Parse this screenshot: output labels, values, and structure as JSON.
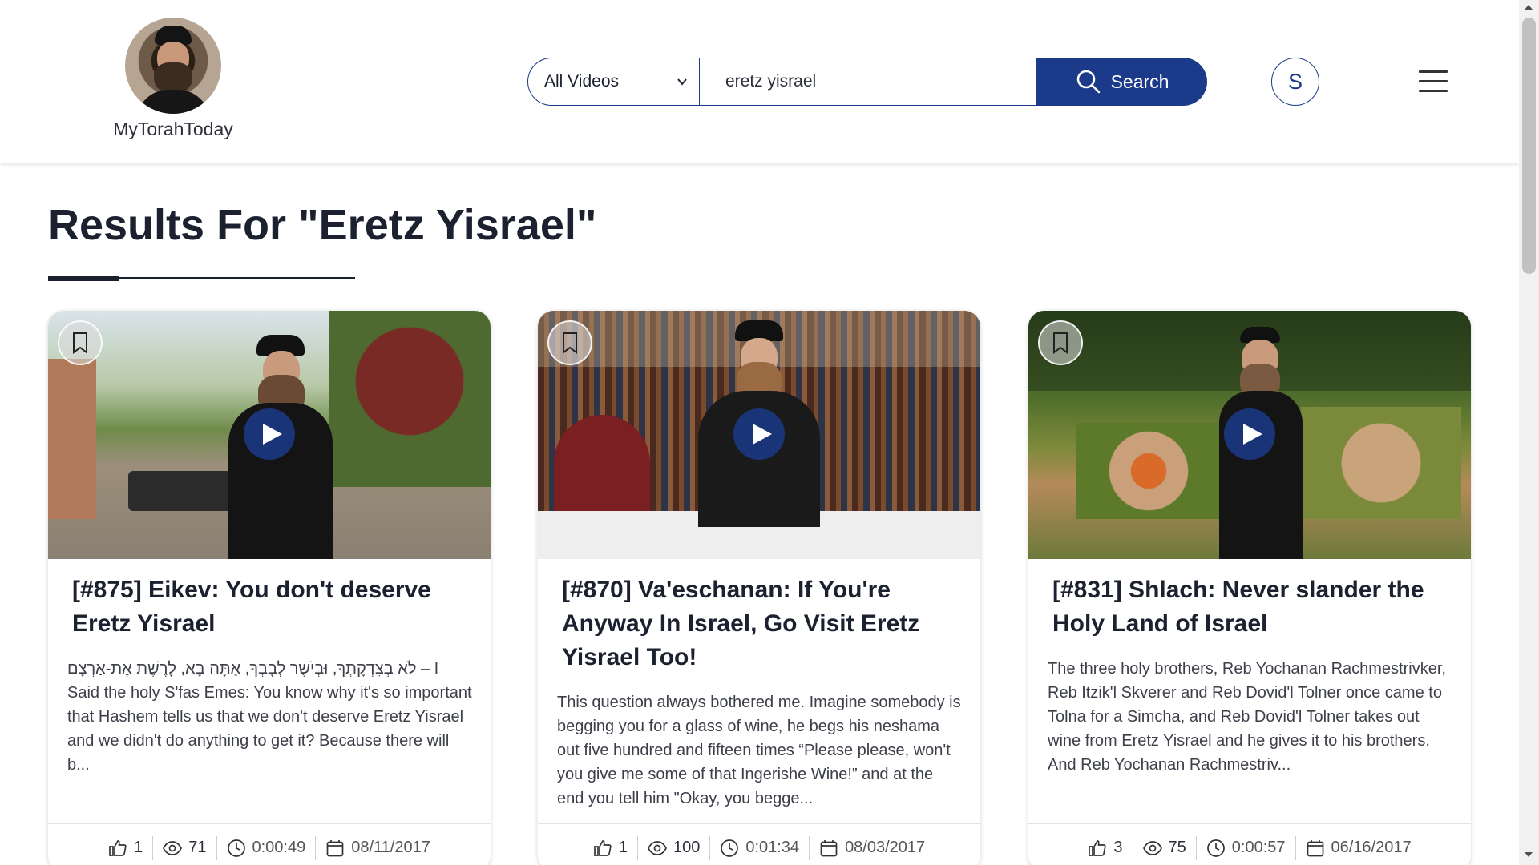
{
  "header": {
    "logo_text": "MyTorahToday",
    "filter_selected": "All Videos",
    "search_value": "eretz yisrael",
    "search_button_label": "Search",
    "user_initial": "S"
  },
  "results_title": "Results For \"Eretz Yisrael\"",
  "cards": [
    {
      "title": "[#875] Eikev: You don't deserve Eretz Yisrael",
      "description": "לֹא בְצִדְקָתְךָ, וּבְיֹשֶׁר לְבָבְךָ, אַתָּה בָא, לָרֶשֶׁת אֶת-אַרְצָם – I Said the holy S'fas Emes: You know why it's so important that Hashem tells us that we don't deserve Eretz Yisrael and we didn't do anything to get it? Because there will b...",
      "likes": "1",
      "views": "71",
      "duration": "0:00:49",
      "date": "08/11/2017"
    },
    {
      "title": "[#870] Va'eschanan: If You're Anyway In Israel, Go Visit Eretz Yisrael Too!",
      "description": "This question always bothered me. Imagine somebody is begging you for a glass of wine, he begs his neshama out five hundred and fifteen times “Please please, won't you give me some of that Ingerishe Wine!” and at the end you tell him \"Okay, you begge...",
      "likes": "1",
      "views": "100",
      "duration": "0:01:34",
      "date": "08/03/2017"
    },
    {
      "title": "[#831] Shlach: Never slander the Holy Land of Israel",
      "description": "The three holy brothers, Reb Yochanan Rachmestrivker, Reb Itzik'l Skverer and Reb Dovid'l Tolner once came to Tolna for a Simcha, and Reb Dovid'l Tolner takes out wine from Eretz Yisrael and he gives it to his brothers. And Reb Yochanan Rachmestriv...",
      "likes": "3",
      "views": "75",
      "duration": "0:00:57",
      "date": "06/16/2017"
    }
  ],
  "icons": {
    "bookmark": "bookmark-icon",
    "play": "play-icon",
    "like": "thumbs-up-icon",
    "views": "eye-icon",
    "duration": "clock-icon",
    "date": "calendar-icon",
    "search": "search-icon",
    "menu": "hamburger-menu-icon"
  },
  "colors": {
    "brand": "#1b3a8a",
    "text": "#1c2130"
  }
}
